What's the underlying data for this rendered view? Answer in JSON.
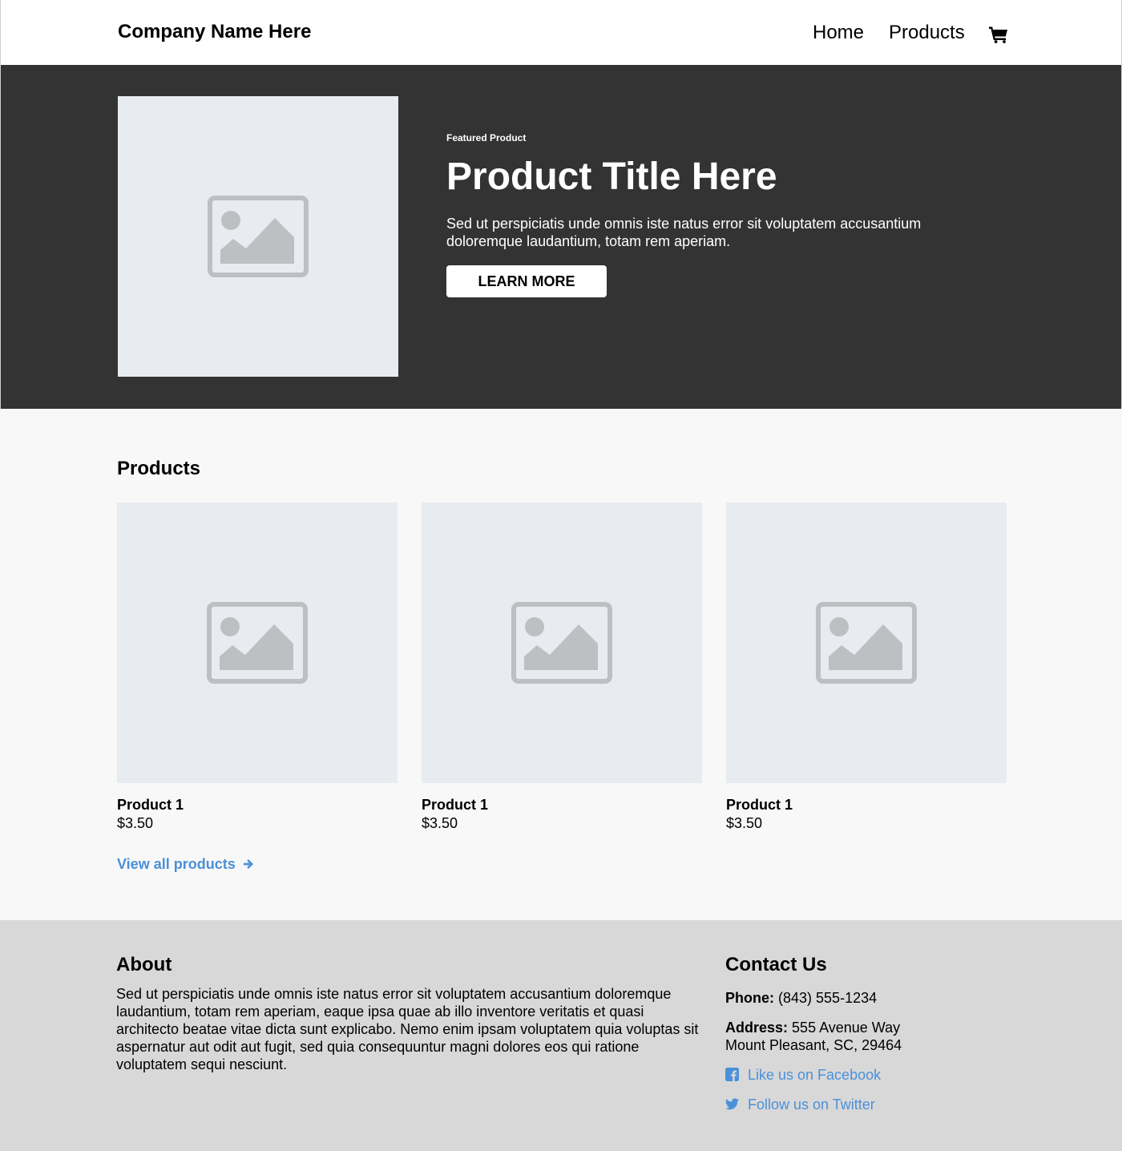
{
  "header": {
    "brand": "Company Name Here",
    "nav": [
      {
        "label": "Home"
      },
      {
        "label": "Products"
      }
    ],
    "cart_icon": "shopping-cart-icon"
  },
  "hero": {
    "eyebrow": "Featured Product",
    "title": "Product Title Here",
    "description": "Sed ut perspiciatis unde omnis iste natus error sit voluptatem accusantium doloremque laudantium, totam rem aperiam.",
    "button_label": "LEARN MORE",
    "image_icon": "image-placeholder-icon"
  },
  "products": {
    "title": "Products",
    "items": [
      {
        "name": "Product 1",
        "price": "$3.50"
      },
      {
        "name": "Product 1",
        "price": "$3.50"
      },
      {
        "name": "Product 1",
        "price": "$3.50"
      }
    ],
    "view_all": "View all products",
    "view_all_icon": "arrow-right-icon"
  },
  "footer": {
    "about": {
      "title": "About",
      "text": "Sed ut perspiciatis unde omnis iste natus error sit voluptatem accusantium doloremque laudantium, totam rem aperiam, eaque ipsa quae ab illo inventore veritatis et quasi architecto beatae vitae dicta sunt explicabo. Nemo enim ipsam voluptatem quia voluptas sit aspernatur aut odit aut fugit, sed quia consequuntur magni dolores eos qui ratione voluptatem sequi nesciunt."
    },
    "contact": {
      "title": "Contact Us",
      "phone_label": "Phone:",
      "phone": "(843) 555-1234",
      "address_label": "Address:",
      "address_line1": "555 Avenue Way",
      "address_line2": "Mount Pleasant, SC, 29464",
      "facebook": "Like us on Facebook",
      "twitter": "Follow us on Twitter",
      "facebook_icon": "facebook-icon",
      "twitter_icon": "twitter-icon"
    }
  },
  "colors": {
    "hero_bg": "#333333",
    "link": "#4a90d9",
    "placeholder_bg": "#e8ebf0",
    "placeholder_icon": "#bdc0c3",
    "footer_bg": "#d8d8d8",
    "page_bg": "#f8f8f8"
  }
}
